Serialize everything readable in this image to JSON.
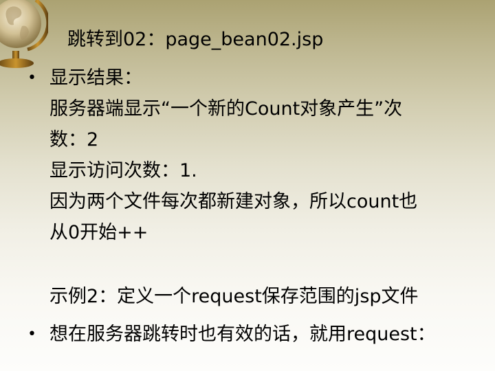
{
  "slide": {
    "title": "跳转到02：page_bean02.jsp",
    "bullet_1": {
      "heading": "显示结果：",
      "lines": [
        "服务器端显示“一个新的Count对象产生”次",
        "数：2",
        "显示访问次数：1.",
        "因为两个文件每次都新建对象，所以count也",
        "从0开始++"
      ]
    },
    "example_line": "示例2：定义一个request保存范围的jsp文件",
    "bullet_2": {
      "text": "想在服务器跳转时也有效的话，就用request："
    },
    "bullet_symbol": "•"
  }
}
